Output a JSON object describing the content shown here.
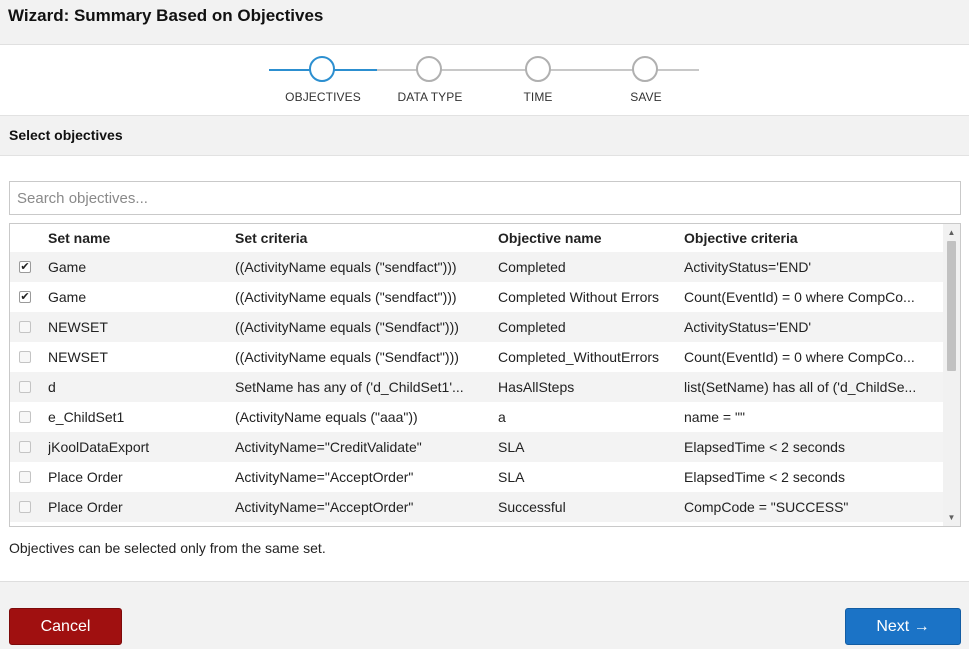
{
  "window": {
    "title": "Wizard: Summary Based on Objectives"
  },
  "stepper": {
    "steps": [
      {
        "label": "OBJECTIVES",
        "active": true
      },
      {
        "label": "DATA TYPE",
        "active": false
      },
      {
        "label": "TIME",
        "active": false
      },
      {
        "label": "SAVE",
        "active": false
      }
    ]
  },
  "section": {
    "title": "Select objectives"
  },
  "search": {
    "placeholder": "Search objectives...",
    "value": ""
  },
  "table": {
    "headers": [
      "Set name",
      "Set criteria",
      "Objective name",
      "Objective criteria"
    ],
    "rows": [
      {
        "checked": true,
        "set_name": "Game",
        "set_criteria": "((ActivityName equals (\"sendfact\")))",
        "objective_name": "Completed",
        "objective_criteria": "ActivityStatus='END'"
      },
      {
        "checked": true,
        "set_name": "Game",
        "set_criteria": "((ActivityName equals (\"sendfact\")))",
        "objective_name": "Completed Without Errors",
        "objective_criteria": "Count(EventId) = 0 where CompCo..."
      },
      {
        "checked": false,
        "set_name": "NEWSET",
        "set_criteria": "((ActivityName equals (\"Sendfact\")))",
        "objective_name": "Completed",
        "objective_criteria": "ActivityStatus='END'"
      },
      {
        "checked": false,
        "set_name": "NEWSET",
        "set_criteria": "((ActivityName equals (\"Sendfact\")))",
        "objective_name": "Completed_WithoutErrors",
        "objective_criteria": "Count(EventId) = 0 where CompCo..."
      },
      {
        "checked": false,
        "set_name": "d",
        "set_criteria": "SetName has any of ('d_ChildSet1'...",
        "objective_name": "HasAllSteps",
        "objective_criteria": "list(SetName) has all of ('d_ChildSe..."
      },
      {
        "checked": false,
        "set_name": "e_ChildSet1",
        "set_criteria": "(ActivityName equals (\"aaa\"))",
        "objective_name": "a",
        "objective_criteria": "name = \"\""
      },
      {
        "checked": false,
        "set_name": "jKoolDataExport",
        "set_criteria": "ActivityName=\"CreditValidate\"",
        "objective_name": "SLA",
        "objective_criteria": "ElapsedTime < 2 seconds"
      },
      {
        "checked": false,
        "set_name": "Place Order",
        "set_criteria": "ActivityName=\"AcceptOrder\"",
        "objective_name": "SLA",
        "objective_criteria": "ElapsedTime < 2 seconds"
      },
      {
        "checked": false,
        "set_name": "Place Order",
        "set_criteria": "ActivityName=\"AcceptOrder\"",
        "objective_name": "Successful",
        "objective_criteria": "CompCode = \"SUCCESS\""
      }
    ]
  },
  "note": "Objectives can be selected only from the same set.",
  "footer": {
    "cancel_label": "Cancel",
    "next_label": "Next →"
  },
  "icons": {
    "checkbox_checked": "check-icon",
    "scroll_up": "triangle-up-icon",
    "scroll_down": "triangle-down-icon"
  },
  "colors": {
    "accent": "#2c8fd0",
    "cancel": "#a01010",
    "next": "#1b73c6"
  }
}
